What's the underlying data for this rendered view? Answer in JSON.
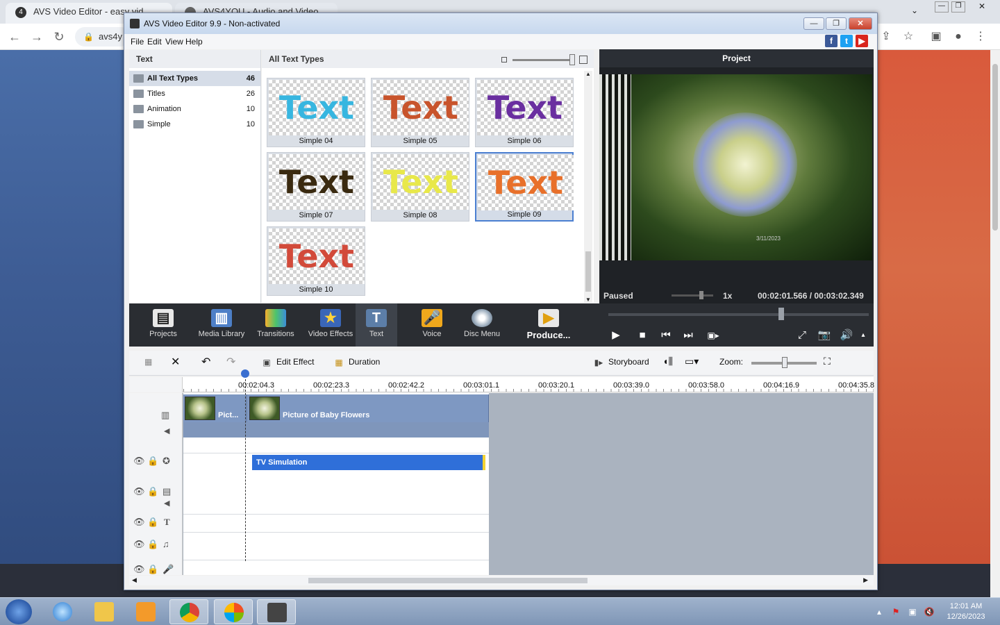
{
  "browser": {
    "tab_title": "AVS Video Editor - easy vid",
    "tab2_title": "AVS4YOU - Audio and Video Edito",
    "url_fragment": "avs4y"
  },
  "window": {
    "title": "AVS Video Editor 9.9 - Non-activated"
  },
  "menu": [
    "File",
    "Edit",
    "View",
    "Help"
  ],
  "categories": {
    "header": "Text",
    "items": [
      {
        "label": "All Text Types",
        "count": "46"
      },
      {
        "label": "Titles",
        "count": "26"
      },
      {
        "label": "Animation",
        "count": "10"
      },
      {
        "label": "Simple",
        "count": "10"
      }
    ]
  },
  "gallery": {
    "header": "All Text Types",
    "items": [
      {
        "label": "Simple 04",
        "sample": "Text",
        "color": "#37b6e0"
      },
      {
        "label": "Simple 05",
        "sample": "Text",
        "color": "#c8542c"
      },
      {
        "label": "Simple 06",
        "sample": "Text",
        "color": "#6a2fa0"
      },
      {
        "label": "Simple 07",
        "sample": "Text",
        "color": "#3a2a10"
      },
      {
        "label": "Simple 08",
        "sample": "Text",
        "color": "#e8e84a"
      },
      {
        "label": "Simple 09",
        "sample": "Text",
        "color": "#e8702a"
      },
      {
        "label": "Simple 10",
        "sample": "Text",
        "color": "#d24a3a"
      }
    ],
    "selected_index": 5
  },
  "preview": {
    "header": "Project",
    "status": "Paused",
    "speed": "1x",
    "time": "00:02:01.566 / 00:03:02.349",
    "overlay_date": "3/11/2023"
  },
  "toolbar": {
    "items": [
      {
        "label": "Projects",
        "icon": "clapper-icon"
      },
      {
        "label": "Media Library",
        "icon": "film-strip-icon"
      },
      {
        "label": "Transitions",
        "icon": "transitions-icon"
      },
      {
        "label": "Video Effects",
        "icon": "star-icon"
      },
      {
        "label": "Text",
        "icon": "text-t-icon"
      },
      {
        "label": "Voice",
        "icon": "microphone-icon"
      },
      {
        "label": "Disc Menu",
        "icon": "disc-icon"
      },
      {
        "label": "Produce...",
        "icon": "produce-icon"
      }
    ],
    "active": "Text"
  },
  "timeline_toolbar": {
    "edit_effect": "Edit Effect",
    "duration": "Duration",
    "storyboard": "Storyboard",
    "zoom": "Zoom:"
  },
  "ruler": [
    "00:02:04.3",
    "00:02:23.3",
    "00:02:42.2",
    "00:03:01.1",
    "00:03:20.1",
    "00:03:39.0",
    "00:03:58.0",
    "00:04:16.9",
    "00:04:35.8"
  ],
  "clips": {
    "clip1": "Pict...",
    "clip2": "Picture of Baby Flowers",
    "effect": "TV Simulation"
  },
  "taskbar": {
    "time": "12:01 AM",
    "date": "12/26/2023"
  }
}
